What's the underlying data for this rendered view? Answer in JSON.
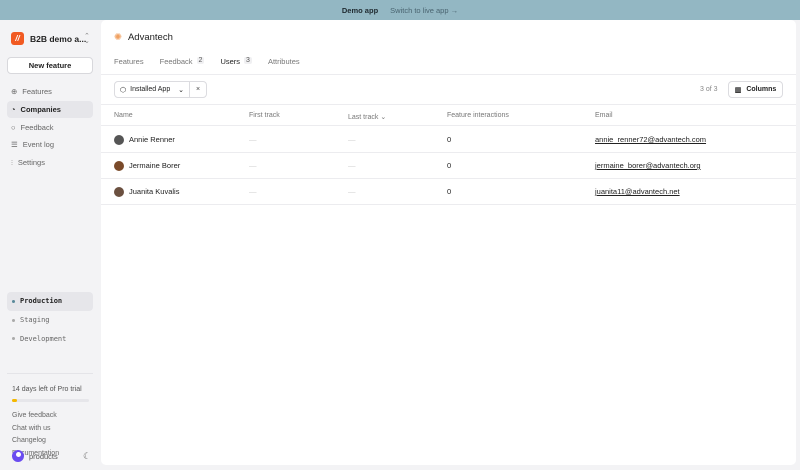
{
  "banner": {
    "title": "Demo app",
    "switch": "Switch to live app →"
  },
  "sidebar": {
    "org": "B2B demo a...",
    "logo": "//",
    "new_feature": "New feature",
    "nav": [
      {
        "label": "Features",
        "icon": "features-icon"
      },
      {
        "label": "Companies",
        "icon": "pie-icon",
        "active": true
      },
      {
        "label": "Feedback",
        "icon": "chat-icon"
      },
      {
        "label": "Event log",
        "icon": "list-icon"
      },
      {
        "label": "Settings",
        "icon": "sliders-icon"
      }
    ],
    "environments": [
      {
        "label": "Production",
        "active": true
      },
      {
        "label": "Staging"
      },
      {
        "label": "Development"
      }
    ],
    "trial": "14 days left of Pro trial",
    "trial_progress": 0.07,
    "links": [
      "Give feedback",
      "Chat with us",
      "Changelog",
      "Documentation"
    ],
    "user": "products"
  },
  "company": {
    "name": "Advantech"
  },
  "tabs": [
    {
      "label": "Features"
    },
    {
      "label": "Feedback",
      "count": "2"
    },
    {
      "label": "Users",
      "count": "3",
      "active": true
    },
    {
      "label": "Attributes"
    }
  ],
  "filter": {
    "label": "Installed App"
  },
  "count": "3 of 3",
  "columns_btn": "Columns",
  "table": {
    "headers": [
      "Name",
      "First track",
      "Last track",
      "Feature interactions",
      "Email"
    ],
    "rows": [
      {
        "name": "Annie Renner",
        "first": "—",
        "last": "—",
        "interactions": "0",
        "email": "annie_renner72@advantech.com",
        "avatar": "#555"
      },
      {
        "name": "Jermaine Borer",
        "first": "—",
        "last": "—",
        "interactions": "0",
        "email": "jermaine_borer@advantech.org",
        "avatar": "#7a4a2a"
      },
      {
        "name": "Juanita Kuvalis",
        "first": "—",
        "last": "—",
        "interactions": "0",
        "email": "juanita11@advantech.net",
        "avatar": "#6b5040"
      }
    ]
  }
}
